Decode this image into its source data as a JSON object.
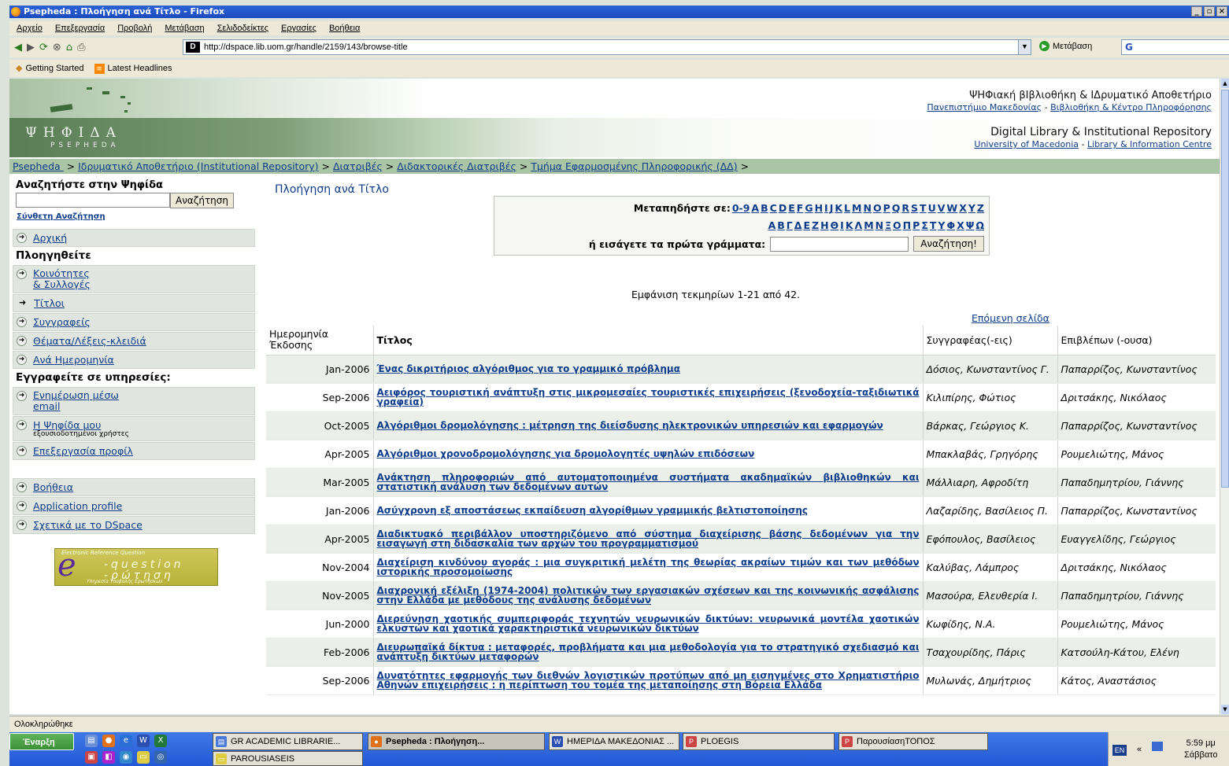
{
  "window": {
    "title": "Psepheda : Πλοήγηση ανά Τίτλο - Firefox"
  },
  "menubar": [
    "Αρχείο",
    "Επεξεργασία",
    "Προβολή",
    "Μετάβαση",
    "Σελιδοδείκτες",
    "Εργασίες",
    "Βοήθεια"
  ],
  "toolbar": {
    "url": "http://dspace.lib.uom.gr/handle/2159/143/browse-title",
    "go_label": "Μετάβαση",
    "search_text": "G"
  },
  "bookmarks": {
    "getting_started": "Getting Started",
    "latest_headlines": "Latest Headlines"
  },
  "banner": {
    "logo_text": "ΨΗΦΙΔΑ",
    "logo_sub": "PSEPHEDA",
    "gr_title": "ΨΗΦιακή βΙβλιοθήκη & ΙΔρυματικό Αποθετήριο",
    "gr_uni": "Πανεπιστήμιο Μακεδονίας",
    "gr_sep": " - ",
    "gr_lib": "Βιβλιοθήκη & Κέντρο Πληροφόρησης",
    "en_title": "Digital Library & Institutional Repository",
    "en_uni": "University of Macedonia",
    "en_sep": " - ",
    "en_lib": "Library & Information Centre"
  },
  "breadcrumb": [
    "Psepheda ",
    "Ιδρυματικό Αποθετήριο (Institutional Repository)",
    "Διατριβές",
    "Διδακτορικές Διατριβές",
    "Τμήμα Εφαρμοσμένης Πληροφορικής (ΔΔ)"
  ],
  "breadcrumb_sep": ">",
  "sidebar": {
    "search_heading": "Αναζητήστε στην Ψηφίδα",
    "search_button": "Αναζήτηση",
    "advanced": "Σύνθετη Αναζήτηση",
    "home": "Αρχική",
    "browse_heading": "Πλοηγηθείτε",
    "communities_1": "Κοινότητες",
    "communities_2": "& Συλλογές",
    "titles": "Τίτλοι",
    "authors": "Συγγραφείς",
    "subjects": "Θέματα/Λέξεις-κλειδιά",
    "by_date": "Ανά Ημερομηνία",
    "subscribe_heading": "Εγγραφείτε σε υπηρεσίες:",
    "email_1": "Ενημέρωση μέσω",
    "email_2": "email",
    "my_1": "Η Ψηφίδα μου",
    "my_2": "εξουσιοδοτημένοι χρήστες",
    "profile": "Επεξεργασία προφίλ",
    "help": "Βοήθεια",
    "app_profile": "Application profile",
    "about": "Σχετικά με το DSpace",
    "equest_top": "Electronic Reference Question",
    "equest_main1": "-question",
    "equest_main2": "-ρώτηση",
    "equest_bottom": "Υπηρεσία Υποβολής Ερωτήσεων"
  },
  "main": {
    "title": "Πλοήγηση ανά Τίτλο",
    "jump_label": "Μεταπηδήστε σε:",
    "latin_letters": [
      "0-9",
      "A",
      "B",
      "C",
      "D",
      "E",
      "F",
      "G",
      "H",
      "I",
      "J",
      "K",
      "L",
      "M",
      "N",
      "O",
      "P",
      "Q",
      "R",
      "S",
      "T",
      "U",
      "V",
      "W",
      "X",
      "Y",
      "Z"
    ],
    "greek_letters": [
      "Α",
      "Β",
      "Γ",
      "Δ",
      "Ε",
      "Ζ",
      "Η",
      "Θ",
      "Ι",
      "Κ",
      "Λ",
      "Μ",
      "Ν",
      "Ξ",
      "Ο",
      "Π",
      "Ρ",
      "Σ",
      "Τ",
      "Υ",
      "Φ",
      "Χ",
      "Ψ",
      "Ω"
    ],
    "first_letters_label": "ή εισάγετε τα πρώτα γράμματα:",
    "search_button": "Αναζήτηση!",
    "count_text": "Εμφάνιση τεκμηρίων 1-21 από 42.",
    "next_page": "Επόμενη σελίδα"
  },
  "table": {
    "headers": {
      "date": "Ημερομηνία Έκδοσης",
      "title": "Τίτλος",
      "author": "Συγγραφέας(-εις)",
      "supervisor": "Επιβλέπων (-ουσα)"
    },
    "rows": [
      {
        "date": "Jan-2006",
        "title": "Ένας δικριτήριος αλγόριθμος για το γραμμικό πρόβλημα",
        "author": "Δόσιος, Κωνσταντίνος Γ.",
        "supervisor": "Παπαρρίζος, Κωνσταντίνος"
      },
      {
        "date": "Sep-2006",
        "title": "Αειφόρος τουριστική ανάπτυξη στις μικρομεσαίες τουριστικές επιχειρήσεις (ξενοδοχεία-ταξιδιωτικά γραφεία)",
        "author": "Κιλιπίρης, Φώτιος",
        "supervisor": "Δριτσάκης, Νικόλαος"
      },
      {
        "date": "Oct-2005",
        "title": "Αλγόριθμοι δρομολόγησης : μέτρηση της διείσδυσης ηλεκτρονικών υπηρεσιών και εφαρμογών",
        "author": "Βάρκας, Γεώργιος Κ.",
        "supervisor": "Παπαρρίζος, Κωνσταντίνος"
      },
      {
        "date": "Apr-2005",
        "title": "Αλγόριθμοι χρονοδρομολόγησης για δρομολογητές υψηλών επιδόσεων",
        "author": "Μπακλαβάς, Γρηγόρης",
        "supervisor": "Ρουμελιώτης, Μάνος"
      },
      {
        "date": "Mar-2005",
        "title": "Ανάκτηση πληροφοριών από αυτοματοποιημένα συστήματα ακαδημαϊκών βιβλιοθηκών και στατιστική ανάλυση των δεδομένων αυτών",
        "author": "Μάλλιαρη, Αφροδίτη",
        "supervisor": "Παπαδημητρίου, Γιάννης"
      },
      {
        "date": "Jan-2006",
        "title": "Ασύγχρονη εξ αποστάσεως εκπαίδευση αλγορίθμων γραμμικής βελτιστοποίησης",
        "author": "Λαζαρίδης, Βασίλειος Π.",
        "supervisor": "Παπαρρίζος, Κωνσταντίνος"
      },
      {
        "date": "Apr-2005",
        "title": "Διαδικτυακό περιβάλλον υποστηριζόμενο από σύστημα διαχείρισης βάσης δεδομένων για την εισαγωγή στη διδασκαλία των αρχών του προγραμματισμού",
        "author": "Εφόπουλος, Βασίλειος",
        "supervisor": "Ευαγγελίδης, Γεώργιος"
      },
      {
        "date": "Nov-2004",
        "title": "Διαχείριση κινδύνου αγοράς : μια συγκριτική μελέτη της θεωρίας ακραίων τιμών και των μεθόδων ιστορικής προσομοίωσης",
        "author": "Καλύβας, Λάμπρος",
        "supervisor": "Δριτσάκης, Νικόλαος"
      },
      {
        "date": "Nov-2005",
        "title": "Διαχρονική εξέλιξη (1974-2004) πολιτικών των εργασιακών σχέσεων και της κοινωνικής ασφάλισης στην Ελλάδα με μεθόδους της ανάλυσης δεδομένων",
        "author": "Μασούρα, Ελευθερία Ι.",
        "supervisor": "Παπαδημητρίου, Γιάννης"
      },
      {
        "date": "Jun-2000",
        "title": "Διερεύνηση χαοτικής συμπεριφοράς τεχνητών νευρωνικών δικτύων: νευρωνικά μοντέλα χαοτικών ελκυστών και χαοτικά χαρακτηριστικά νευρωνικών δικτύων",
        "author": "Κωφίδης, Ν.Α.",
        "supervisor": "Ρουμελιώτης, Μάνος"
      },
      {
        "date": "Feb-2006",
        "title": "Διευρωπαϊκά δίκτυα : μεταφορές, προβλήματα και μια μεθοδολογία για το στρατηγικό σχεδιασμό και ανάπτυξη δικτύων μεταφορών",
        "author": "Τσαχουρίδης, Πάρις",
        "supervisor": "Κατσούλη-Κάτου, Ελένη"
      },
      {
        "date": "Sep-2006",
        "title": "Δυνατότητες εφαρμογής των διεθνών λογιστικών προτύπων από μη εισηγμένες στο Χρηματιστήριο Αθηνών επιχειρήσεις : η περίπτωση του τομέα της μεταποίησης στη Βόρεια Ελλάδα",
        "author": "Μυλωνάς, Δημήτριος",
        "supervisor": "Κάτος, Αναστάσιος"
      }
    ]
  },
  "statusbar": "Ολοκληρώθηκε",
  "taskbar": {
    "start": "Έναρξη",
    "tasks": [
      "GR ACADEMIC LIBRARIE...",
      "Psepheda : Πλοήγηση...",
      "ΗΜΕΡΙΔΑ ΜΑΚΕΔΟΝΙΑΣ ...",
      "PLOEGIS",
      "ΠαρουσίασηΤΟΠΟΣ",
      "PAROUSIASEIS"
    ],
    "lang": "EN",
    "time": "5:59 μμ",
    "day": "Σάββατο"
  }
}
